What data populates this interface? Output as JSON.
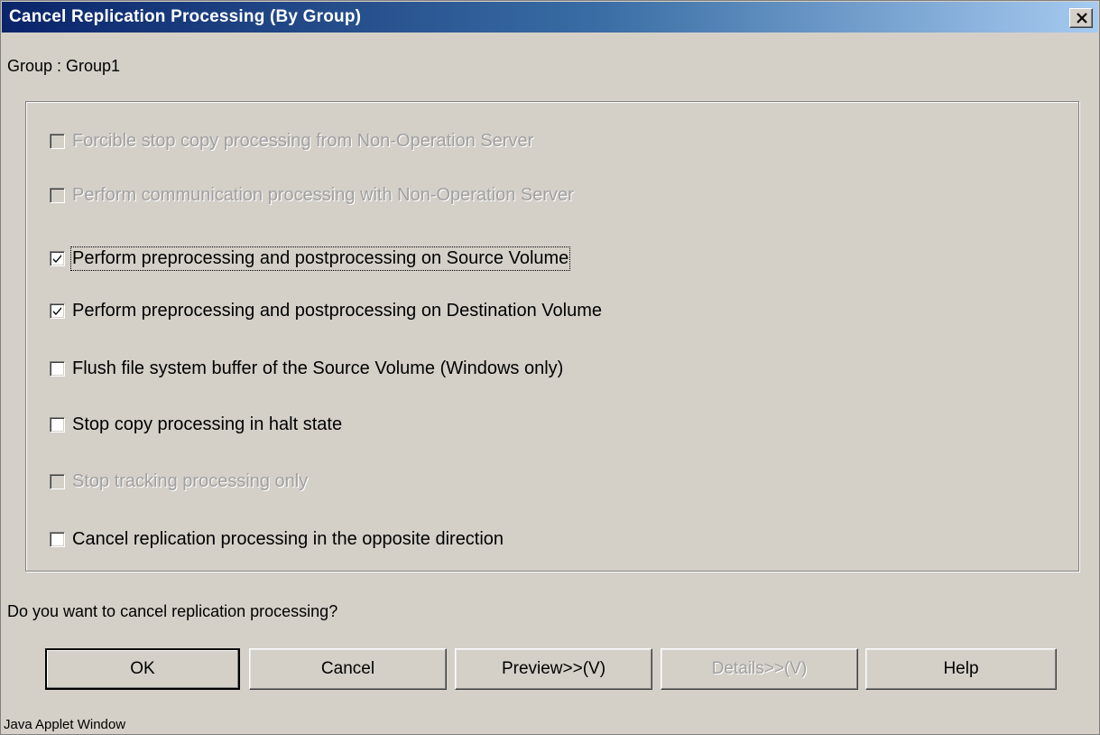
{
  "window": {
    "title": "Cancel Replication Processing (By Group)",
    "close_glyph": "✕"
  },
  "group": {
    "label": "Group : Group1"
  },
  "options": [
    {
      "label": "Forcible stop copy processing from Non-Operation Server",
      "checked": false,
      "enabled": false
    },
    {
      "label": "Perform communication processing with Non-Operation Server",
      "checked": false,
      "enabled": false
    },
    {
      "label": "Perform preprocessing and postprocessing on Source Volume",
      "checked": true,
      "enabled": true,
      "focused": true
    },
    {
      "label": "Perform preprocessing and postprocessing on Destination Volume",
      "checked": true,
      "enabled": true
    },
    {
      "label": "Flush file system buffer of the Source Volume (Windows only)",
      "checked": false,
      "enabled": true
    },
    {
      "label": "Stop copy processing in halt state",
      "checked": false,
      "enabled": true
    },
    {
      "label": "Stop tracking processing only",
      "checked": false,
      "enabled": false
    },
    {
      "label": "Cancel replication processing in the opposite direction",
      "checked": false,
      "enabled": true
    }
  ],
  "question": "Do you want to cancel replication processing?",
  "buttons": {
    "ok": "OK",
    "cancel": "Cancel",
    "preview": "Preview>>(V)",
    "details": "Details>>(V)",
    "help": "Help"
  },
  "footer": "Java Applet Window"
}
